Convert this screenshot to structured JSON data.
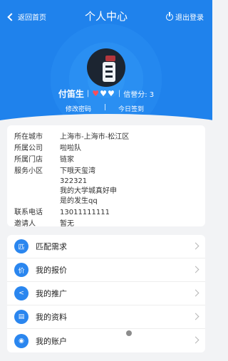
{
  "header": {
    "back_label": "返回首页",
    "title": "个人中心",
    "logout_label": "退出登录"
  },
  "profile": {
    "name": "付笛生",
    "credit_label": "信誉分",
    "credit_value": "3",
    "hearts_total": 3,
    "hearts_filled": 1,
    "change_password_label": "修改密码",
    "checkin_label": "今日签到"
  },
  "info": [
    {
      "key": "所在城市",
      "value": "上海市-上海市-松江区"
    },
    {
      "key": "所属公司",
      "value": "啦啦队"
    },
    {
      "key": "所属门店",
      "value": "链家"
    },
    {
      "key": "服务小区",
      "value": "下哦天玺湾\n322321\n我的大学城真好申\n是的发生qq"
    },
    {
      "key": "联系电话",
      "value": "13011111111"
    },
    {
      "key": "邀请人",
      "value": "暂无"
    }
  ],
  "menu": [
    {
      "label": "匹配需求",
      "icon": "match-icon",
      "glyph": "匹"
    },
    {
      "label": "我的报价",
      "icon": "quote-icon",
      "glyph": "价"
    },
    {
      "label": "我的推广",
      "icon": "share-icon",
      "glyph": "<"
    },
    {
      "label": "我的资料",
      "icon": "profile-data-icon",
      "glyph": "▤"
    },
    {
      "label": "我的账户",
      "icon": "account-icon",
      "glyph": "◉"
    }
  ],
  "colors": {
    "accent": "#2a86ef",
    "hero": "#1f82ec",
    "heart_filled": "#ff4d5a",
    "heart_empty": "#ffffff"
  }
}
